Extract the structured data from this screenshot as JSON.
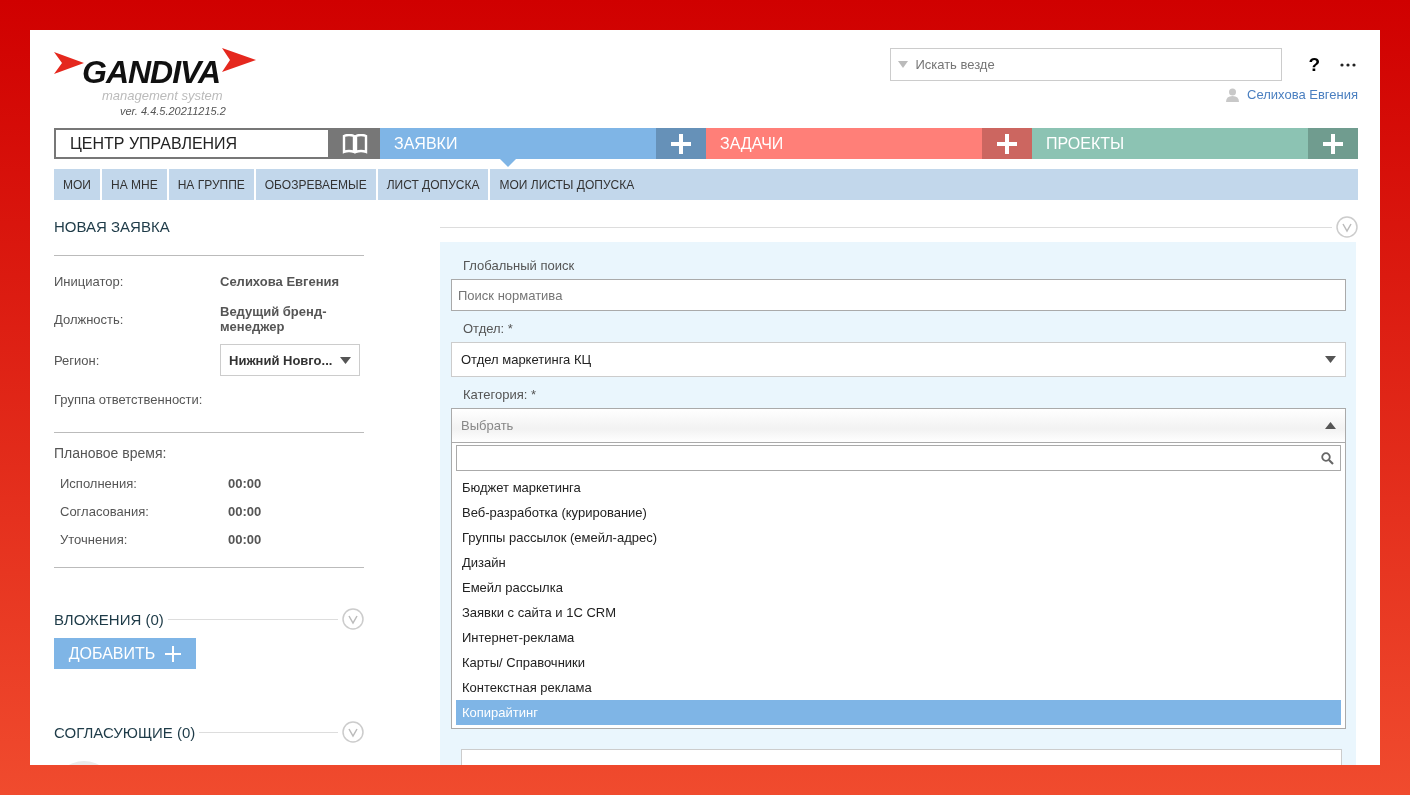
{
  "logo": {
    "name": "GANDIVA",
    "subtitle": "management system",
    "version": "ver. 4.4.5.20211215.2"
  },
  "header": {
    "search": {
      "placeholder": "Искать везде"
    },
    "help": "?",
    "user": "Селихова Евгения"
  },
  "nav": {
    "control_center": "ЦЕНТР УПРАВЛЕНИЯ",
    "sections": [
      {
        "label": "ЗАЯВКИ",
        "color": "#7fb5e6",
        "selected": true
      },
      {
        "label": "ЗАДАЧИ",
        "color": "#ff7f78",
        "selected": false
      },
      {
        "label": "ПРОЕКТЫ",
        "color": "#8cc3b3",
        "selected": false
      }
    ]
  },
  "subtabs": [
    "МОИ",
    "НА МНЕ",
    "НА ГРУППЕ",
    "ОБОЗРЕВАЕМЫЕ",
    "ЛИСТ ДОПУСКА",
    "МОИ ЛИСТЫ ДОПУСКА"
  ],
  "form": {
    "title": "НОВАЯ ЗАЯВКА",
    "info": [
      {
        "label": "Инициатор:",
        "value": "Селихова Евгения",
        "kind": "text"
      },
      {
        "label": "Должность:",
        "value": "Ведущий бренд-менеджер",
        "kind": "text"
      },
      {
        "label": "Регион:",
        "value": "Нижний Новго...",
        "kind": "select"
      },
      {
        "label": "Группа ответственности:",
        "kind": "text"
      }
    ],
    "planned_time": {
      "title": "Плановое время:",
      "rows": [
        {
          "label": "Исполнения:",
          "value": "00:00"
        },
        {
          "label": "Согласования:",
          "value": "00:00"
        },
        {
          "label": "Уточнения:",
          "value": "00:00"
        }
      ]
    },
    "attachments": {
      "title": "ВЛОЖЕНИЯ (0)",
      "add_button": "ДОБАВИТЬ"
    },
    "approvers": {
      "title": "СОГЛАСУЮЩИЕ (0)"
    }
  },
  "details": {
    "global_search": {
      "label": "Глобальный поиск",
      "placeholder": "Поиск норматива"
    },
    "department": {
      "label": "Отдел: *",
      "value": "Отдел маркетинга КЦ"
    },
    "category": {
      "label": "Категория: *",
      "placeholder": "Выбрать",
      "expanded": true,
      "options": [
        {
          "label": "Бюджет маркетинга",
          "selected": false
        },
        {
          "label": "Веб-разработка (курирование)",
          "selected": false
        },
        {
          "label": "Группы рассылок (емейл-адрес)",
          "selected": false
        },
        {
          "label": "Дизайн",
          "selected": false
        },
        {
          "label": "Емейл рассылка",
          "selected": false
        },
        {
          "label": "Заявки с сайта и 1С CRM",
          "selected": false
        },
        {
          "label": "Интернет-реклама",
          "selected": false
        },
        {
          "label": "Карты/ Справочники",
          "selected": false
        },
        {
          "label": "Контекстная реклама",
          "selected": false
        },
        {
          "label": "Копирайтинг",
          "selected": true
        }
      ]
    }
  }
}
